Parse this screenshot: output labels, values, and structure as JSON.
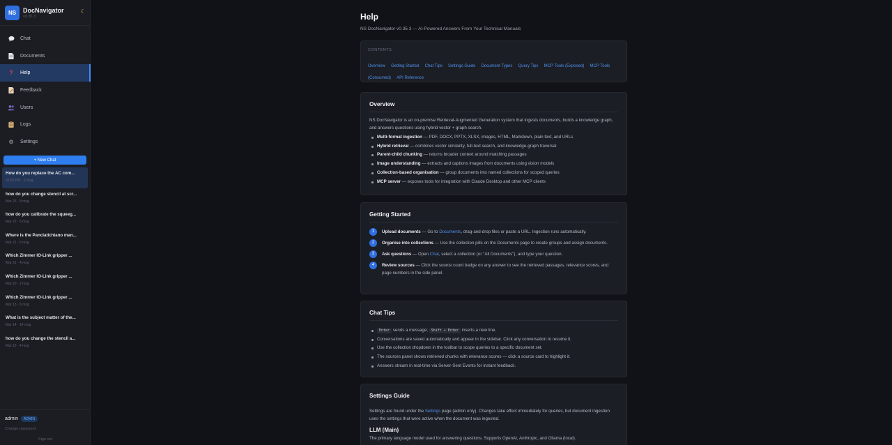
{
  "app": {
    "logo": "NS",
    "name": "DocNavigator",
    "version": "v0.35.3",
    "theme_icon": "moon-icon"
  },
  "nav": [
    {
      "label": "Chat",
      "icon": "chat-icon"
    },
    {
      "label": "Documents",
      "icon": "document-icon"
    },
    {
      "label": "Help",
      "icon": "help-icon",
      "active": true
    },
    {
      "label": "Feedback",
      "icon": "feedback-icon"
    },
    {
      "label": "Users",
      "icon": "users-icon"
    },
    {
      "label": "Logs",
      "icon": "logs-icon"
    },
    {
      "label": "Settings",
      "icon": "gear-icon"
    }
  ],
  "new_chat_label": "+ New Chat",
  "chats": [
    {
      "title": "How do you replace the AC com...",
      "meta": "05:52 PM · 2 msg"
    },
    {
      "title": "how do you change stencil at scr...",
      "meta": "Mar 26 · 8 msg"
    },
    {
      "title": "how do you calibrate the squeeg...",
      "meta": "Mar 22 · 6 msg"
    },
    {
      "title": "Where is the Panciatichiano man...",
      "meta": "Mar 21 · 6 msg"
    },
    {
      "title": "Which Zimmer IO-Link gripper ...",
      "meta": "Mar 21 · 4 msg"
    },
    {
      "title": "Which Zimmer IO-Link gripper ...",
      "meta": "Mar 20 · 2 msg"
    },
    {
      "title": "Which Zimmer IO-Link gripper ...",
      "meta": "Mar 15 · 6 msg"
    },
    {
      "title": "What is the subject matter of the...",
      "meta": "Mar 14 · 14 msg"
    },
    {
      "title": "how do you change the stencil a...",
      "meta": "Mar 12 · 4 msg"
    }
  ],
  "user": {
    "name": "admin",
    "role": "ADMIN",
    "change_password": "Change password",
    "sign_out": "Sign out"
  },
  "page": {
    "title": "Help",
    "subtitle": "NS DocNavigator v0.35.3 — AI-Powered Answers From Your Technical Manuals"
  },
  "toc": {
    "heading": "CONTENTS",
    "links": [
      "Overview",
      "Getting Started",
      "Chat Tips",
      "Settings Guide",
      "Document Types",
      "Query Tips",
      "MCP Tools (Exposed)",
      "MCP Tools (Consumed)",
      "API Reference"
    ]
  },
  "overview": {
    "title": "Overview",
    "intro": "NS DocNavigator is an on-premise Retrieval-Augmented Generation system that ingests documents, builds a knowledge graph, and answers questions using hybrid vector + graph search.",
    "features": [
      {
        "name": "Multi-format ingestion",
        "desc": " — PDF, DOCX, PPTX, XLSX, images, HTML, Markdown, plain text, and URLs"
      },
      {
        "name": "Hybrid retrieval",
        "desc": " — combines vector similarity, full-text search, and knowledge-graph traversal"
      },
      {
        "name": "Parent-child chunking",
        "desc": " — returns broader context around matching passages"
      },
      {
        "name": "Image understanding",
        "desc": " — extracts and captions images from documents using vision models"
      },
      {
        "name": "Collection-based organisation",
        "desc": " — group documents into named collections for scoped queries"
      },
      {
        "name": "MCP server",
        "desc": " — exposes tools for integration with Claude Desktop and other MCP clients"
      }
    ]
  },
  "getting_started": {
    "title": "Getting Started",
    "steps": [
      {
        "n": "1",
        "name": "Upload documents",
        "pre": " — Go to ",
        "link": "Documents",
        "post": ", drag-and-drop files or paste a URL. Ingestion runs automatically."
      },
      {
        "n": "2",
        "name": "Organise into collections",
        "pre": " — Use the collection pills on the Documents page to create groups and assign documents.",
        "link": "",
        "post": ""
      },
      {
        "n": "3",
        "name": "Ask questions",
        "pre": " — Open ",
        "link": "Chat",
        "post": ", select a collection (or \"All Documents\"), and type your question."
      },
      {
        "n": "4",
        "name": "Review sources",
        "pre": " — Click the source count badge on any answer to see the retrieved passages, relevance scores, and page numbers in the side panel.",
        "link": "",
        "post": ""
      }
    ]
  },
  "chat_tips": {
    "title": "Chat Tips",
    "tip1": {
      "key1": "Enter",
      "mid": "sends a message; ",
      "key2": "Shift + Enter",
      "end": "inserts a new line."
    },
    "tips": [
      "Conversations are saved automatically and appear in the sidebar. Click any conversation to resume it.",
      "Use the collection dropdown in the toolbar to scope queries to a specific document set.",
      "The sources panel shows retrieved chunks with relevance scores — click a source card to highlight it.",
      "Answers stream in real-time via Server-Sent Events for instant feedback."
    ]
  },
  "settings_guide": {
    "title": "Settings Guide",
    "pre": "Settings are found under the ",
    "link": "Settings",
    "post": " page (admin only). Changes take effect immediately for queries, but document ingestion uses the settings that were active when the document was ingested.",
    "llm_title": "LLM (Main)",
    "llm_desc": "The primary language model used for answering questions. Supports OpenAI, Anthropic, and Ollama (local)."
  }
}
